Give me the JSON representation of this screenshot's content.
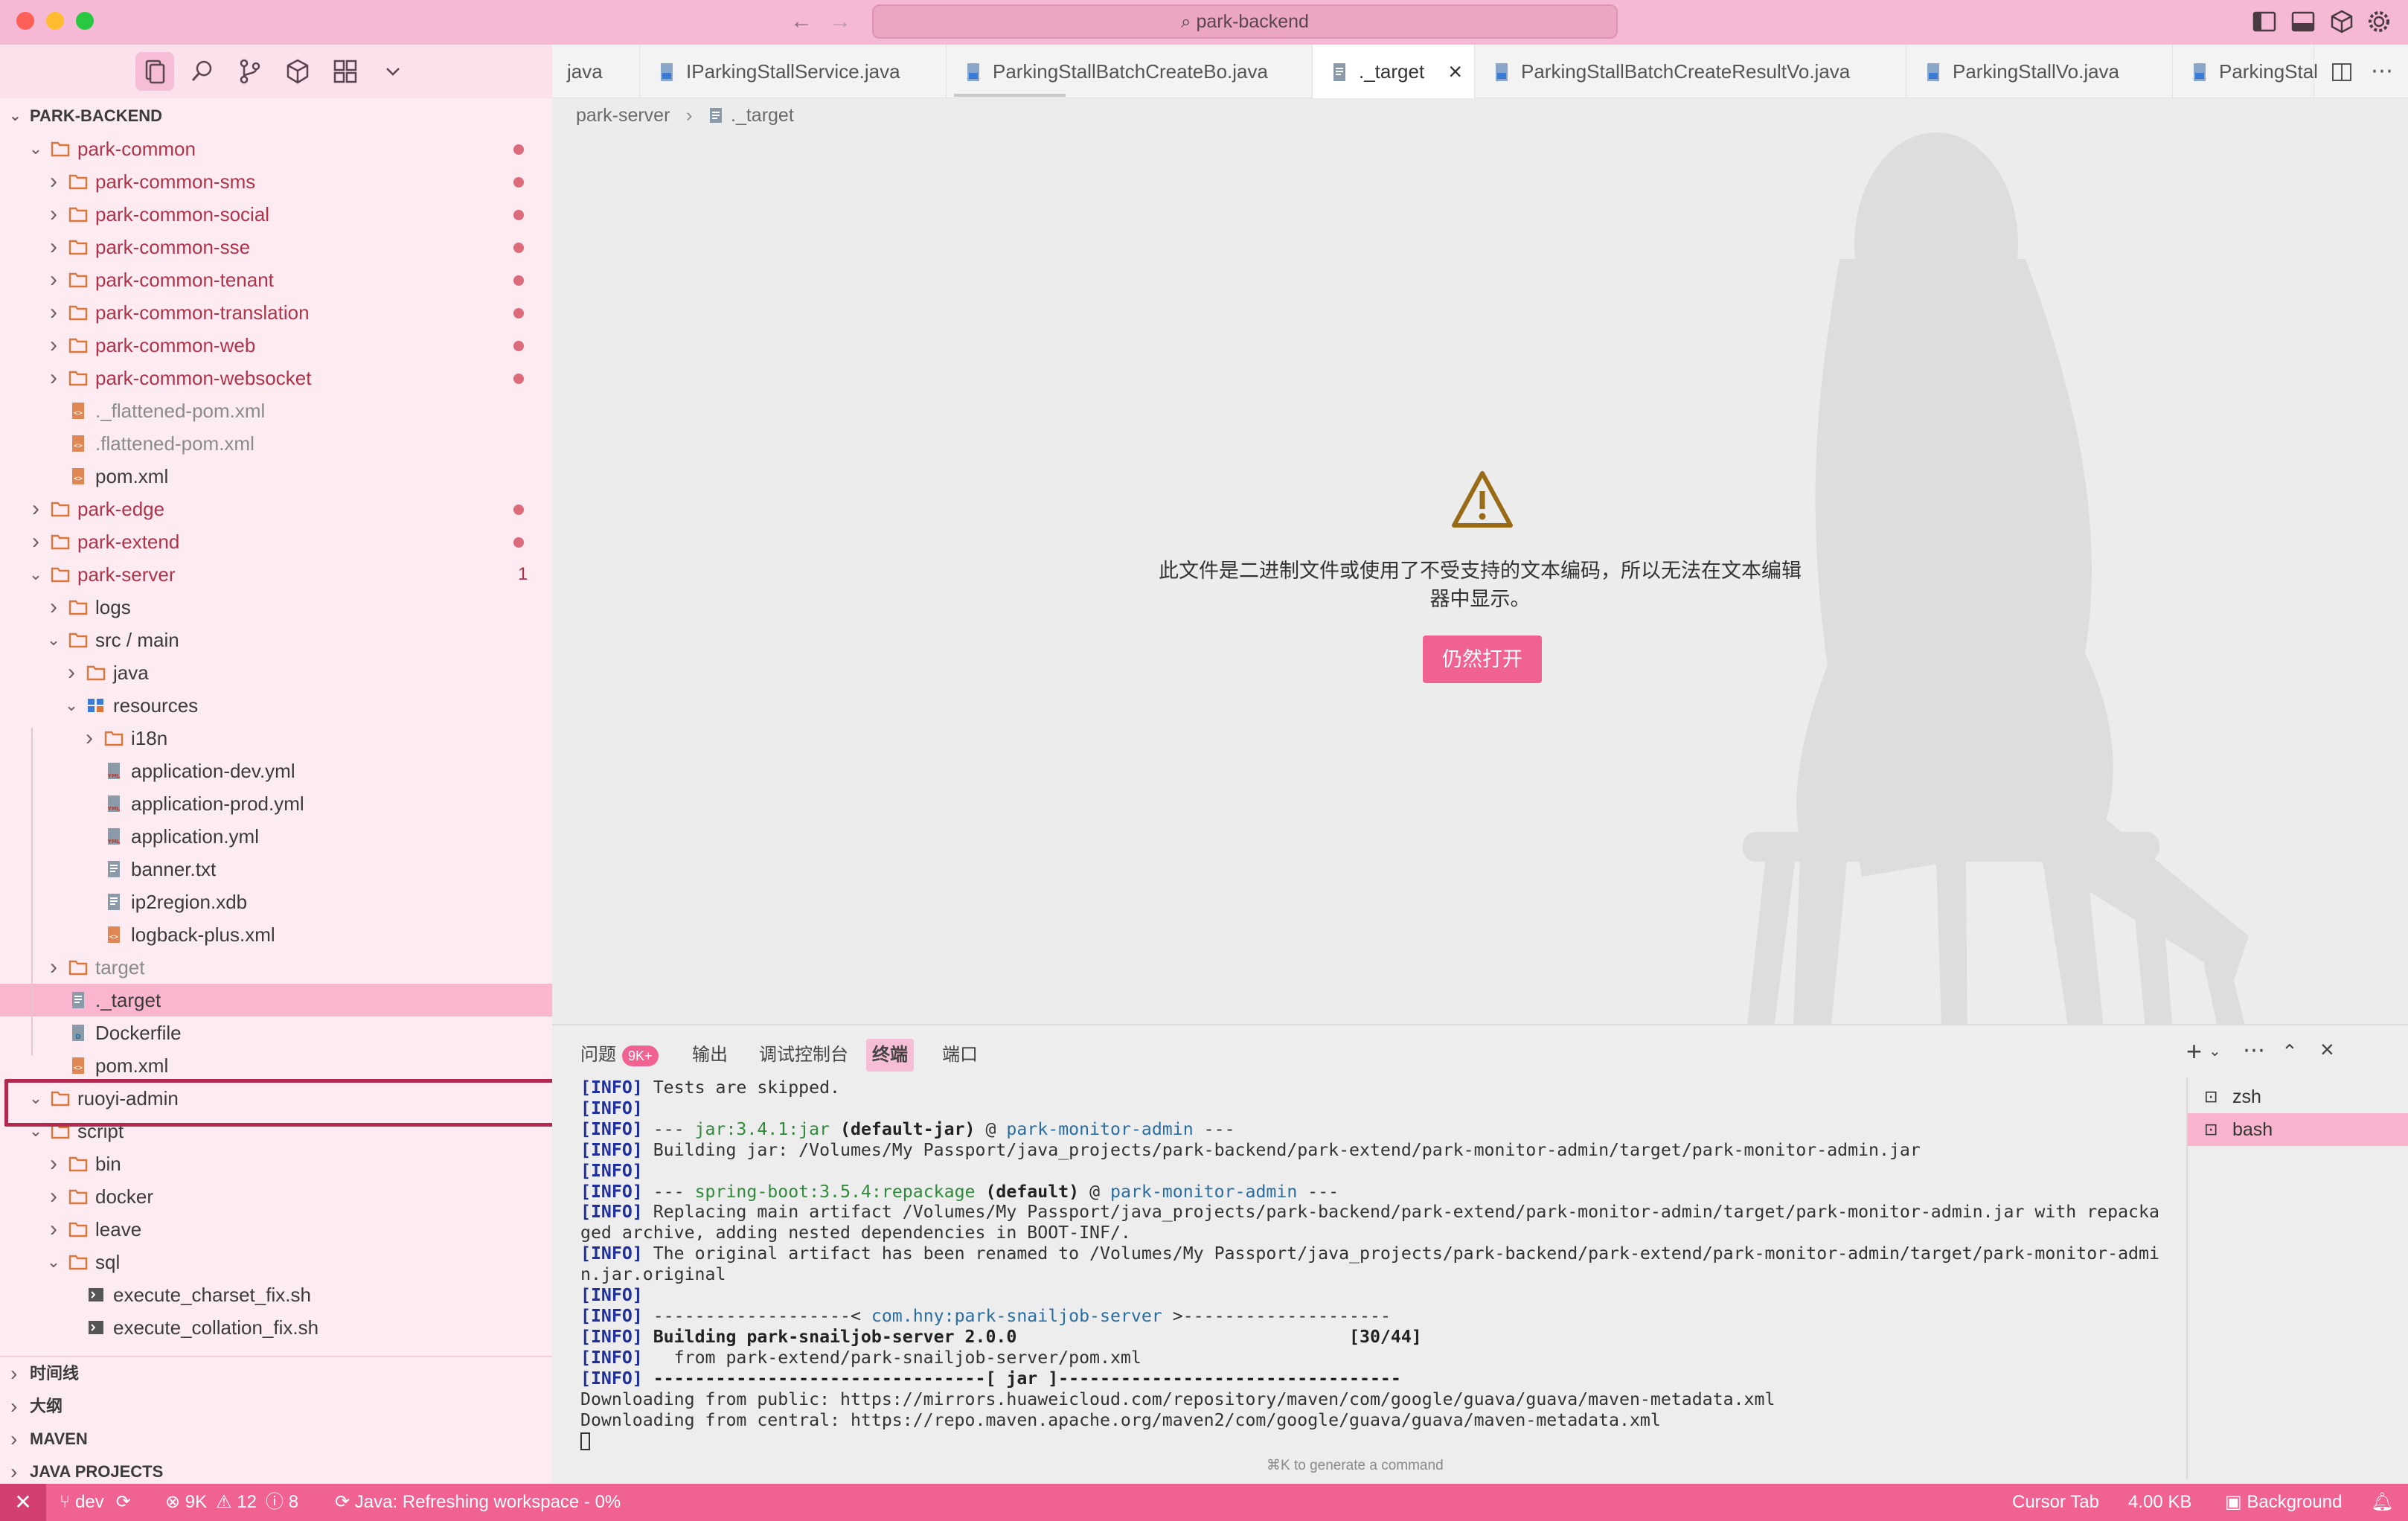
{
  "titlebar": {
    "search_text": "park-backend"
  },
  "explorer": {
    "root_title": "PARK-BACKEND",
    "rows": [
      {
        "label": "park-common",
        "kind": "folder",
        "open": true,
        "git": "dot",
        "color": "red"
      },
      {
        "label": "park-common-sms",
        "kind": "folder",
        "open": false,
        "git": "dot",
        "color": "red"
      },
      {
        "label": "park-common-social",
        "kind": "folder",
        "open": false,
        "git": "dot",
        "color": "red"
      },
      {
        "label": "park-common-sse",
        "kind": "folder",
        "open": false,
        "git": "dot",
        "color": "red"
      },
      {
        "label": "park-common-tenant",
        "kind": "folder",
        "open": false,
        "git": "dot",
        "color": "red"
      },
      {
        "label": "park-common-translation",
        "kind": "folder",
        "open": false,
        "git": "dot",
        "color": "red"
      },
      {
        "label": "park-common-web",
        "kind": "folder",
        "open": false,
        "git": "dot",
        "color": "red"
      },
      {
        "label": "park-common-websocket",
        "kind": "folder",
        "open": false,
        "git": "dot",
        "color": "red"
      },
      {
        "label": "._flattened-pom.xml",
        "kind": "xml",
        "color": "grey"
      },
      {
        "label": ".flattened-pom.xml",
        "kind": "xml",
        "color": "grey"
      },
      {
        "label": "pom.xml",
        "kind": "xml",
        "color": "normal"
      },
      {
        "label": "park-edge",
        "kind": "folder",
        "open": false,
        "git": "dot",
        "color": "red"
      },
      {
        "label": "park-extend",
        "kind": "folder",
        "open": false,
        "git": "dot",
        "color": "red"
      },
      {
        "label": "park-server",
        "kind": "folder",
        "open": true,
        "git": "1",
        "color": "red"
      },
      {
        "label": "logs",
        "kind": "folder",
        "open": false,
        "color": "normal"
      },
      {
        "label": "src / main",
        "kind": "folder",
        "open": true,
        "color": "normal"
      },
      {
        "label": "java",
        "kind": "folder",
        "open": false,
        "color": "normal"
      },
      {
        "label": "resources",
        "kind": "resfolder",
        "open": true,
        "color": "normal"
      },
      {
        "label": "i18n",
        "kind": "folder",
        "open": false,
        "color": "normal"
      },
      {
        "label": "application-dev.yml",
        "kind": "yml",
        "color": "normal"
      },
      {
        "label": "application-prod.yml",
        "kind": "yml",
        "color": "normal"
      },
      {
        "label": "application.yml",
        "kind": "yml",
        "color": "normal"
      },
      {
        "label": "banner.txt",
        "kind": "txt",
        "color": "normal"
      },
      {
        "label": "ip2region.xdb",
        "kind": "txt",
        "color": "normal"
      },
      {
        "label": "logback-plus.xml",
        "kind": "xml",
        "color": "normal"
      },
      {
        "label": "target",
        "kind": "folder",
        "open": false,
        "color": "grey"
      },
      {
        "label": "._target",
        "kind": "txt",
        "color": "normal",
        "selected": true
      },
      {
        "label": "Dockerfile",
        "kind": "docker",
        "color": "normal"
      },
      {
        "label": "pom.xml",
        "kind": "xml",
        "color": "normal"
      },
      {
        "label": "ruoyi-admin",
        "kind": "folder",
        "open": true,
        "color": "normal"
      },
      {
        "label": "script",
        "kind": "folder",
        "open": true,
        "color": "normal"
      },
      {
        "label": "bin",
        "kind": "folder",
        "open": false,
        "color": "normal"
      },
      {
        "label": "docker",
        "kind": "folder",
        "open": false,
        "color": "normal"
      },
      {
        "label": "leave",
        "kind": "folder",
        "open": false,
        "color": "normal"
      },
      {
        "label": "sql",
        "kind": "folder",
        "open": true,
        "color": "normal"
      },
      {
        "label": "execute_charset_fix.sh",
        "kind": "sh",
        "color": "normal"
      },
      {
        "label": "execute_collation_fix.sh",
        "kind": "sh",
        "color": "normal"
      }
    ],
    "sections": [
      "时间线",
      "大纲",
      "MAVEN",
      "JAVA PROJECTS"
    ]
  },
  "tabs": [
    {
      "label": "java"
    },
    {
      "label": "IParkingStallService.java"
    },
    {
      "label": "ParkingStallBatchCreateBo.java"
    },
    {
      "label": "._target",
      "active": true,
      "close": "×"
    },
    {
      "label": "ParkingStallBatchCreateResultVo.java"
    },
    {
      "label": "ParkingStallVo.java"
    },
    {
      "label": "ParkingStal"
    }
  ],
  "breadcrumb": {
    "part1": "park-server",
    "sep": "›",
    "part2": "._target"
  },
  "editor": {
    "warning_line1": "此文件是二进制文件或使用了不受支持的文本编码，所以无法在文本编辑",
    "warning_line2": "器中显示。",
    "open_anyway": "仍然打开"
  },
  "panel": {
    "tabs": [
      "问题",
      "输出",
      "调试控制台",
      "终端",
      "端口"
    ],
    "problems_badge": "9K+",
    "active_tab": "终端",
    "terminals": [
      "zsh",
      "bash"
    ],
    "hint": "⌘K to generate a command",
    "lines": [
      {
        "tag": "[INFO]",
        "text": " Tests are skipped."
      },
      {
        "tag": "[INFO]",
        "text": ""
      },
      {
        "tag": "[INFO]",
        "text": " --- ",
        "g": "jar:3.4.1:jar",
        "b": " (default-jar)",
        "t": " @ ",
        "c": "park-monitor-admin",
        "e": " ---"
      },
      {
        "tag": "[INFO]",
        "text": " Building jar: /Volumes/My Passport/java_projects/park-backend/park-extend/park-monitor-admin/target/park-monitor-admin.jar"
      },
      {
        "tag": "[INFO]",
        "text": ""
      },
      {
        "tag": "[INFO]",
        "text": " --- ",
        "g": "spring-boot:3.5.4:repackage",
        "b": " (default)",
        "t": " @ ",
        "c": "park-monitor-admin",
        "e": " ---"
      },
      {
        "tag": "[INFO]",
        "text": " Replacing main artifact /Volumes/My Passport/java_projects/park-backend/park-extend/park-monitor-admin/target/park-monitor-admin.jar with repacka"
      },
      {
        "tag": "",
        "text": "ged archive, adding nested dependencies in BOOT-INF/."
      },
      {
        "tag": "[INFO]",
        "text": " The original artifact has been renamed to /Volumes/My Passport/java_projects/park-backend/park-extend/park-monitor-admin/target/park-monitor-admi"
      },
      {
        "tag": "",
        "text": "n.jar.original"
      },
      {
        "tag": "[INFO]",
        "text": ""
      },
      {
        "tag": "[INFO]",
        "text": " -------------------< ",
        "c": "com.hny:park-snailjob-server",
        "e": " >--------------------"
      },
      {
        "tag": "[INFO]",
        "text": "",
        "bold": " Building park-snailjob-server 2.0.0                                [30/44]"
      },
      {
        "tag": "[INFO]",
        "text": "   from park-extend/park-snailjob-server/pom.xml"
      },
      {
        "tag": "[INFO]",
        "text": "",
        "bold": " --------------------------------[ jar ]---------------------------------"
      },
      {
        "tag": "",
        "text": "Downloading from public: https://mirrors.huaweicloud.com/repository/maven/com/google/guava/guava/maven-metadata.xml"
      },
      {
        "tag": "",
        "text": "Downloading from central: https://repo.maven.apache.org/maven2/com/google/guava/guava/maven-metadata.xml"
      }
    ]
  },
  "statusbar": {
    "branch": "dev",
    "errors": "9K",
    "warnings": "12",
    "infos": "8",
    "java_status": "Java: Refreshing workspace - 0%",
    "cursor_tab": "Cursor Tab",
    "size": "4.00 KB",
    "background": "Background"
  },
  "colors": {
    "accent": "#f06292",
    "titlebar": "#f5b9d5",
    "sidebar": "#fdebf2",
    "selection": "#fbb6cf"
  }
}
